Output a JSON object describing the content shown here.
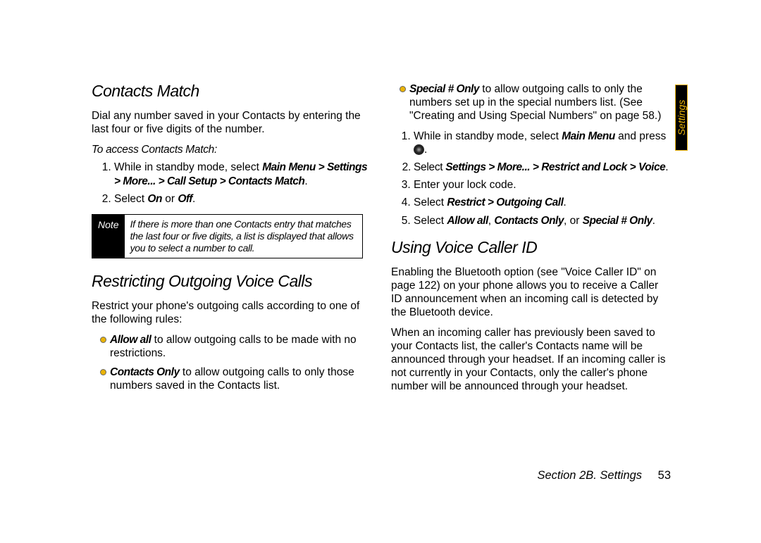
{
  "tab_label": "Settings",
  "footer": {
    "section": "Section 2B. Settings",
    "page": "53"
  },
  "left": {
    "h1": "Contacts Match",
    "p1": "Dial any number saved in your Contacts by entering the last four or five digits of the number.",
    "instr1": "To access Contacts Match:",
    "s1_a": "While in standby mode, select ",
    "s1_b": "Main Menu > Settings > More... > Call Setup > Contacts Match",
    "s1_c": ".",
    "s2_a": "Select ",
    "s2_b": "On",
    "s2_c": " or ",
    "s2_d": "Off",
    "s2_e": ".",
    "note_label": "Note",
    "note_body": "If there is more than one Contacts entry that matches the last four or five digits, a list is displayed that allows you to select a number to call.",
    "h2": "Restricting Outgoing Voice Calls",
    "p2": "Restrict your phone's outgoing calls according to one of the following rules:",
    "b1_a": "Allow all",
    "b1_b": " to allow outgoing calls to be made with no restrictions.",
    "b2_a": "Contacts Only",
    "b2_b": " to allow outgoing calls to only those numbers saved in the Contacts list."
  },
  "right": {
    "b3_a": "Special # Only",
    "b3_b": " to allow outgoing calls to only the numbers set up in the special numbers list. (See \"Creating and Using Special Numbers\" on page 58.)",
    "r1_a": "While in standby mode, select ",
    "r1_b": "Main Menu",
    "r1_c": " and press ",
    "r1_d": ".",
    "r2_a": "Select ",
    "r2_b": "Settings > More... > Restrict and Lock > Voice",
    "r2_c": ".",
    "r3": "Enter your lock code.",
    "r4_a": "Select ",
    "r4_b": "Restrict > Outgoing Call",
    "r4_c": ".",
    "r5_a": "Select ",
    "r5_b": "Allow all",
    "r5_c": ", ",
    "r5_d": "Contacts Only",
    "r5_e": ", or ",
    "r5_f": "Special # Only",
    "r5_g": ".",
    "h3": "Using Voice Caller ID",
    "p3": "Enabling the Bluetooth option (see \"Voice Caller ID\" on page 122) on your phone allows you to receive a Caller ID announcement when an incoming call is detected by the Bluetooth device.",
    "p4": "When an incoming caller has previously been saved to your Contacts list, the caller's Contacts name will be announced through your headset. If an incoming caller is not currently in your Contacts, only the caller's phone number will be announced through your headset."
  }
}
